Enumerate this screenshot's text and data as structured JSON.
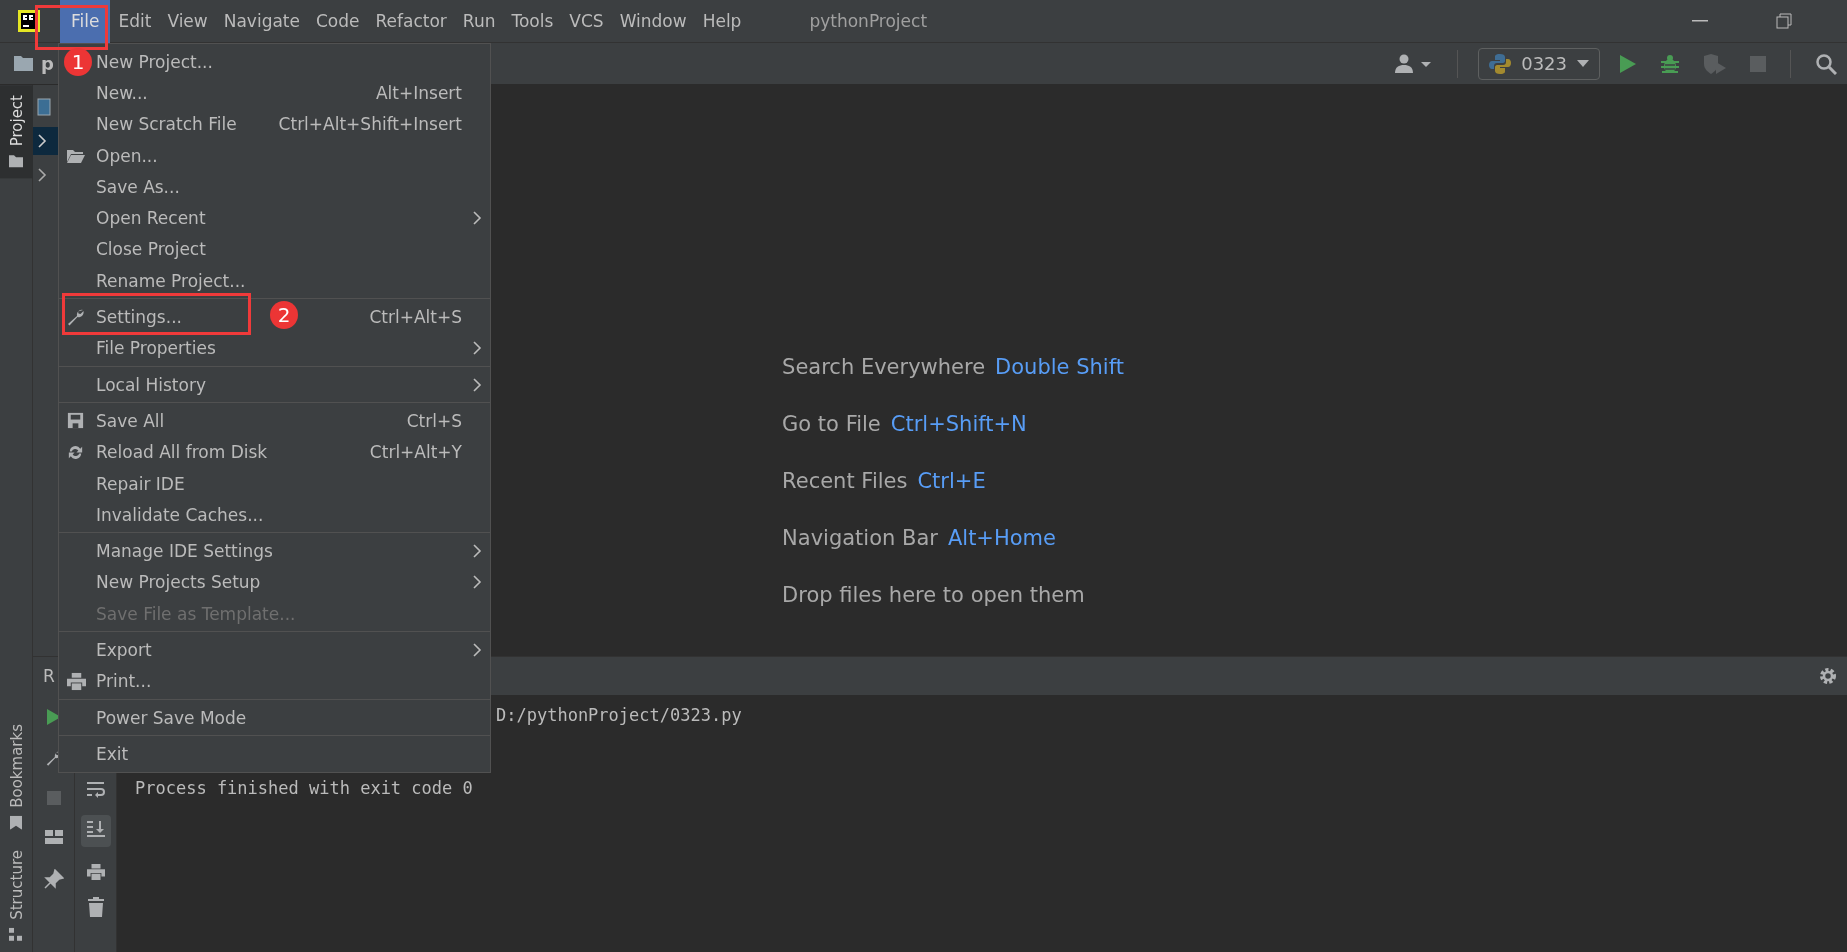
{
  "window": {
    "title": "pythonProject",
    "menu": [
      {
        "label": "File",
        "selected": true
      },
      {
        "label": "Edit",
        "selected": false
      },
      {
        "label": "View",
        "selected": false
      },
      {
        "label": "Navigate",
        "selected": false
      },
      {
        "label": "Code",
        "selected": false
      },
      {
        "label": "Refactor",
        "selected": false
      },
      {
        "label": "Run",
        "selected": false
      },
      {
        "label": "Tools",
        "selected": false
      },
      {
        "label": "VCS",
        "selected": false
      },
      {
        "label": "Window",
        "selected": false
      },
      {
        "label": "Help",
        "selected": false
      }
    ]
  },
  "toolbar": {
    "project_name": "p",
    "run_config": "0323"
  },
  "tool_strip": [
    {
      "label": "Project",
      "selected": true
    },
    {
      "label": "Bookmarks",
      "selected": false
    },
    {
      "label": "Structure",
      "selected": false
    }
  ],
  "file_menu": [
    {
      "items": [
        {
          "label": "New Project...",
          "submenu": false,
          "disabled": false
        },
        {
          "label": "New...",
          "shortcut": "Alt+Insert",
          "submenu": false,
          "disabled": false
        },
        {
          "label": "New Scratch File",
          "shortcut": "Ctrl+Alt+Shift+Insert",
          "submenu": false,
          "disabled": false
        },
        {
          "label": "Open...",
          "submenu": false,
          "disabled": false
        },
        {
          "label": "Save As...",
          "submenu": false,
          "disabled": false
        },
        {
          "label": "Open Recent",
          "submenu": true,
          "disabled": false
        },
        {
          "label": "Close Project",
          "submenu": false,
          "disabled": false
        },
        {
          "label": "Rename Project...",
          "submenu": false,
          "disabled": false
        }
      ]
    },
    {
      "items": [
        {
          "label": "Settings...",
          "shortcut": "Ctrl+Alt+S",
          "submenu": false,
          "disabled": false
        },
        {
          "label": "File Properties",
          "submenu": true,
          "disabled": false
        }
      ]
    },
    {
      "items": [
        {
          "label": "Local History",
          "submenu": true,
          "disabled": false
        }
      ]
    },
    {
      "items": [
        {
          "label": "Save All",
          "shortcut": "Ctrl+S",
          "submenu": false,
          "disabled": false
        },
        {
          "label": "Reload All from Disk",
          "shortcut": "Ctrl+Alt+Y",
          "submenu": false,
          "disabled": false
        },
        {
          "label": "Repair IDE",
          "submenu": false,
          "disabled": false
        },
        {
          "label": "Invalidate Caches...",
          "submenu": false,
          "disabled": false
        }
      ]
    },
    {
      "items": [
        {
          "label": "Manage IDE Settings",
          "submenu": true,
          "disabled": false
        },
        {
          "label": "New Projects Setup",
          "submenu": true,
          "disabled": false
        },
        {
          "label": "Save File as Template...",
          "submenu": false,
          "disabled": true
        }
      ]
    },
    {
      "items": [
        {
          "label": "Export",
          "submenu": true,
          "disabled": false
        },
        {
          "label": "Print...",
          "submenu": false,
          "disabled": false
        }
      ]
    },
    {
      "items": [
        {
          "label": "Power Save Mode",
          "submenu": false,
          "disabled": false
        }
      ]
    },
    {
      "items": [
        {
          "label": "Exit",
          "submenu": false,
          "disabled": false
        }
      ]
    }
  ],
  "editor_hints": [
    {
      "label": "Search Everywhere",
      "shortcut": "Double Shift"
    },
    {
      "label": "Go to File",
      "shortcut": "Ctrl+Shift+N"
    },
    {
      "label": "Recent Files",
      "shortcut": "Ctrl+E"
    },
    {
      "label": "Navigation Bar",
      "shortcut": "Alt+Home"
    },
    {
      "label": "Drop files here to open them"
    }
  ],
  "run_panel": {
    "tab": "R",
    "console": [
      "D:/pythonProject/0323.py",
      "Process finished with exit code 0"
    ]
  },
  "annotations": [
    {
      "number": "1"
    },
    {
      "number": "2"
    }
  ]
}
